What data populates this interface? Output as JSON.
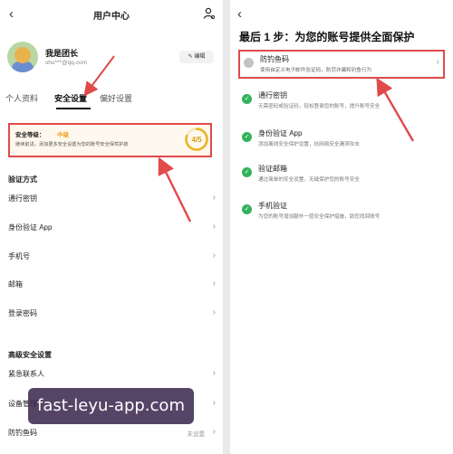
{
  "left": {
    "back_glyph": "‹",
    "title": "用户中心",
    "icons": [
      "back-chevron-icon",
      "person-settings-icon",
      "edit-icon",
      "chevron-right-icon"
    ],
    "profile": {
      "name": "我是团长",
      "email": "shu***@qq.com",
      "edit_label": "✎ 编辑"
    },
    "tabs": [
      {
        "label": "个人资料"
      },
      {
        "label": "安全设置",
        "active": true
      },
      {
        "label": "偏好设置"
      }
    ],
    "security": {
      "label": "安全等级：",
      "value": "中级",
      "description": "继续前进，添加更多安全设置为您的账号安全保驾护航",
      "score": "4/5",
      "score_fraction": 0.8,
      "value_color": "#f29c1c",
      "highlight_color": "#e04a4a"
    },
    "verify_section": {
      "heading": "验证方式",
      "items": [
        "通行密钥",
        "身份验证 App",
        "手机号",
        "邮箱",
        "登录密码"
      ]
    },
    "advanced_section": {
      "heading": "高级安全设置",
      "items": [
        {
          "label": "紧急联系人",
          "value": ""
        },
        {
          "label": "设备管理",
          "value": ""
        },
        {
          "label": "防钓鱼码",
          "value": "未设置"
        }
      ]
    },
    "chevron": "›",
    "watermark": "fast-leyu-app.com"
  },
  "right": {
    "back_glyph": "‹",
    "title": "最后 1 步：为您的账号提供全面保护",
    "phishing": {
      "title": "防钓鱼码",
      "description": "使用自定义电子邮件验证码，防范诈骗和钓鱼行为"
    },
    "check_glyph": "✓",
    "check_color": "#33b25b",
    "features": [
      {
        "title": "通行密钥",
        "description": "无需密码或验证码，轻松登录您的账号，提升账号安全"
      },
      {
        "title": "身份验证 App",
        "description": "添加离线安全保护设置，抗网络安全漏洞攻击"
      },
      {
        "title": "验证邮箱",
        "description": "通过简单的安全设置，无缝保护您的账号安全"
      },
      {
        "title": "手机验证",
        "description": "为您的账号增加额外一层安全保护措施，助您找回账号"
      }
    ]
  }
}
